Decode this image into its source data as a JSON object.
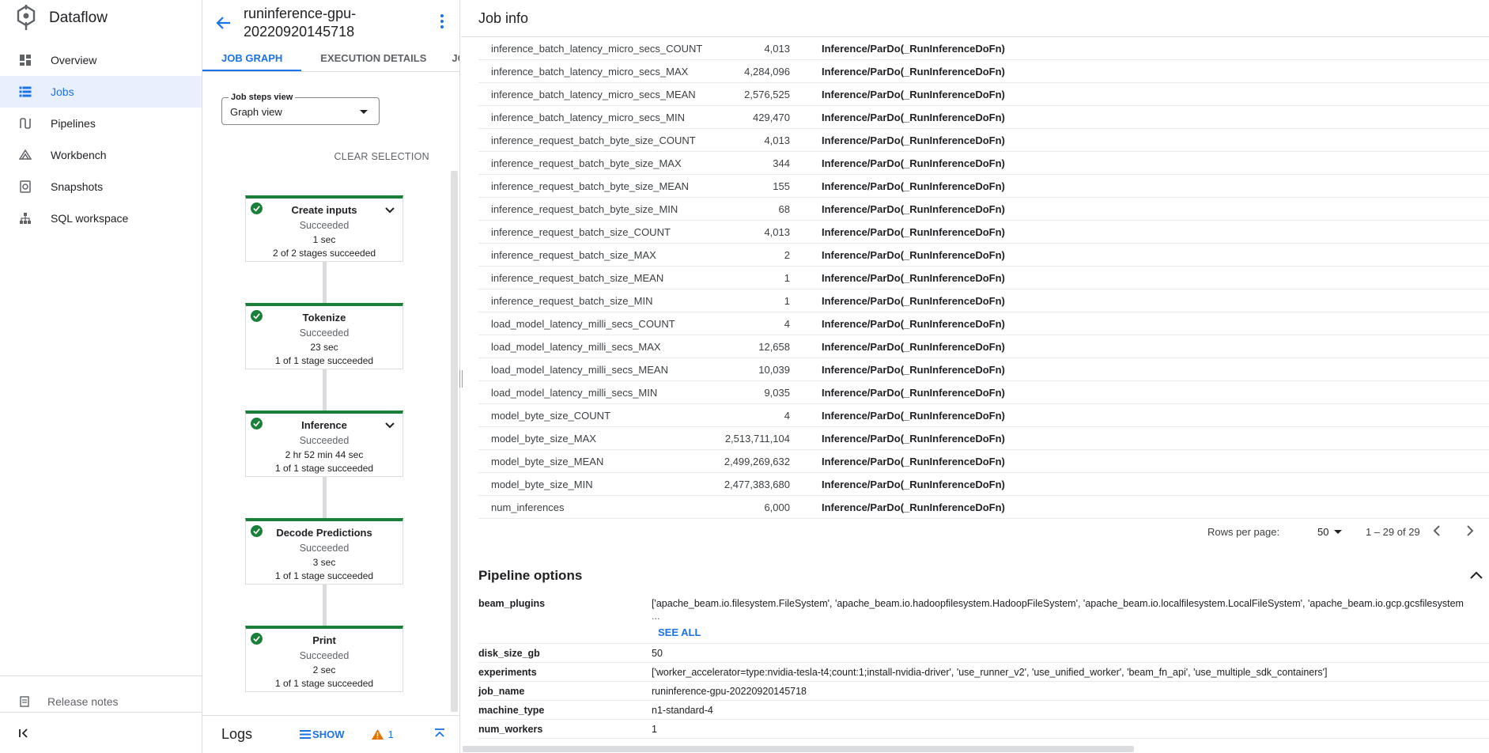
{
  "app": {
    "name": "Dataflow"
  },
  "nav": {
    "items": [
      {
        "label": "Overview",
        "icon": "dashboard-icon"
      },
      {
        "label": "Jobs",
        "icon": "list-icon",
        "active": true
      },
      {
        "label": "Pipelines",
        "icon": "pipelines-icon"
      },
      {
        "label": "Workbench",
        "icon": "workbench-icon"
      },
      {
        "label": "Snapshots",
        "icon": "snapshot-icon"
      },
      {
        "label": "SQL workspace",
        "icon": "sql-workspace-icon"
      }
    ],
    "release_notes": "Release notes"
  },
  "job": {
    "title": "runinference-gpu-20220920145718",
    "tabs": [
      "JOB GRAPH",
      "EXECUTION DETAILS",
      "JOB METRICS"
    ],
    "steps_view": {
      "label": "Job steps view",
      "value": "Graph view"
    },
    "clear_selection": "CLEAR SELECTION",
    "steps": [
      {
        "name": "Create inputs",
        "status": "Succeeded",
        "time": "1 sec",
        "stages": "2 of 2 stages succeeded",
        "expandable": true
      },
      {
        "name": "Tokenize",
        "status": "Succeeded",
        "time": "23 sec",
        "stages": "1 of 1 stage succeeded",
        "expandable": false
      },
      {
        "name": "Inference",
        "status": "Succeeded",
        "time": "2 hr 52 min 44 sec",
        "stages": "1 of 1 stage succeeded",
        "expandable": true
      },
      {
        "name": "Decode Predictions",
        "status": "Succeeded",
        "time": "3 sec",
        "stages": "1 of 1 stage succeeded",
        "expandable": false
      },
      {
        "name": "Print",
        "status": "Succeeded",
        "time": "2 sec",
        "stages": "1 of 1 stage succeeded",
        "expandable": false
      }
    ]
  },
  "logs": {
    "title": "Logs",
    "show": "SHOW",
    "warning_count": "1"
  },
  "job_info": {
    "title": "Job info",
    "metrics": [
      {
        "name": "inference_batch_latency_micro_secs_COUNT",
        "value": "4,013",
        "step": "Inference/ParDo(_RunInferenceDoFn)"
      },
      {
        "name": "inference_batch_latency_micro_secs_MAX",
        "value": "4,284,096",
        "step": "Inference/ParDo(_RunInferenceDoFn)"
      },
      {
        "name": "inference_batch_latency_micro_secs_MEAN",
        "value": "2,576,525",
        "step": "Inference/ParDo(_RunInferenceDoFn)"
      },
      {
        "name": "inference_batch_latency_micro_secs_MIN",
        "value": "429,470",
        "step": "Inference/ParDo(_RunInferenceDoFn)"
      },
      {
        "name": "inference_request_batch_byte_size_COUNT",
        "value": "4,013",
        "step": "Inference/ParDo(_RunInferenceDoFn)"
      },
      {
        "name": "inference_request_batch_byte_size_MAX",
        "value": "344",
        "step": "Inference/ParDo(_RunInferenceDoFn)"
      },
      {
        "name": "inference_request_batch_byte_size_MEAN",
        "value": "155",
        "step": "Inference/ParDo(_RunInferenceDoFn)"
      },
      {
        "name": "inference_request_batch_byte_size_MIN",
        "value": "68",
        "step": "Inference/ParDo(_RunInferenceDoFn)"
      },
      {
        "name": "inference_request_batch_size_COUNT",
        "value": "4,013",
        "step": "Inference/ParDo(_RunInferenceDoFn)"
      },
      {
        "name": "inference_request_batch_size_MAX",
        "value": "2",
        "step": "Inference/ParDo(_RunInferenceDoFn)"
      },
      {
        "name": "inference_request_batch_size_MEAN",
        "value": "1",
        "step": "Inference/ParDo(_RunInferenceDoFn)"
      },
      {
        "name": "inference_request_batch_size_MIN",
        "value": "1",
        "step": "Inference/ParDo(_RunInferenceDoFn)"
      },
      {
        "name": "load_model_latency_milli_secs_COUNT",
        "value": "4",
        "step": "Inference/ParDo(_RunInferenceDoFn)"
      },
      {
        "name": "load_model_latency_milli_secs_MAX",
        "value": "12,658",
        "step": "Inference/ParDo(_RunInferenceDoFn)"
      },
      {
        "name": "load_model_latency_milli_secs_MEAN",
        "value": "10,039",
        "step": "Inference/ParDo(_RunInferenceDoFn)"
      },
      {
        "name": "load_model_latency_milli_secs_MIN",
        "value": "9,035",
        "step": "Inference/ParDo(_RunInferenceDoFn)"
      },
      {
        "name": "model_byte_size_COUNT",
        "value": "4",
        "step": "Inference/ParDo(_RunInferenceDoFn)"
      },
      {
        "name": "model_byte_size_MAX",
        "value": "2,513,711,104",
        "step": "Inference/ParDo(_RunInferenceDoFn)"
      },
      {
        "name": "model_byte_size_MEAN",
        "value": "2,499,269,632",
        "step": "Inference/ParDo(_RunInferenceDoFn)"
      },
      {
        "name": "model_byte_size_MIN",
        "value": "2,477,383,680",
        "step": "Inference/ParDo(_RunInferenceDoFn)"
      },
      {
        "name": "num_inferences",
        "value": "6,000",
        "step": "Inference/ParDo(_RunInferenceDoFn)"
      }
    ],
    "pagination": {
      "rows_per_page_label": "Rows per page:",
      "rows_per_page": "50",
      "range": "1 – 29 of 29"
    },
    "pipeline_options": {
      "title": "Pipeline options",
      "see_all": "SEE ALL",
      "ellipsis": "...",
      "rows": [
        {
          "key": "beam_plugins",
          "value": "['apache_beam.io.filesystem.FileSystem', 'apache_beam.io.hadoopfilesystem.HadoopFileSystem', 'apache_beam.io.localfilesystem.LocalFileSystem', 'apache_beam.io.gcp.gcsfilesystem",
          "truncated": true
        },
        {
          "key": "disk_size_gb",
          "value": "50"
        },
        {
          "key": "experiments",
          "value": "['worker_accelerator=type:nvidia-tesla-t4;count:1;install-nvidia-driver', 'use_runner_v2', 'use_unified_worker', 'beam_fn_api', 'use_multiple_sdk_containers']"
        },
        {
          "key": "job_name",
          "value": "runinference-gpu-20220920145718"
        },
        {
          "key": "machine_type",
          "value": "n1-standard-4"
        },
        {
          "key": "num_workers",
          "value": "1"
        }
      ]
    }
  },
  "colors": {
    "accent": "#1a73e8",
    "success": "#188038",
    "warning": "#e37400"
  }
}
